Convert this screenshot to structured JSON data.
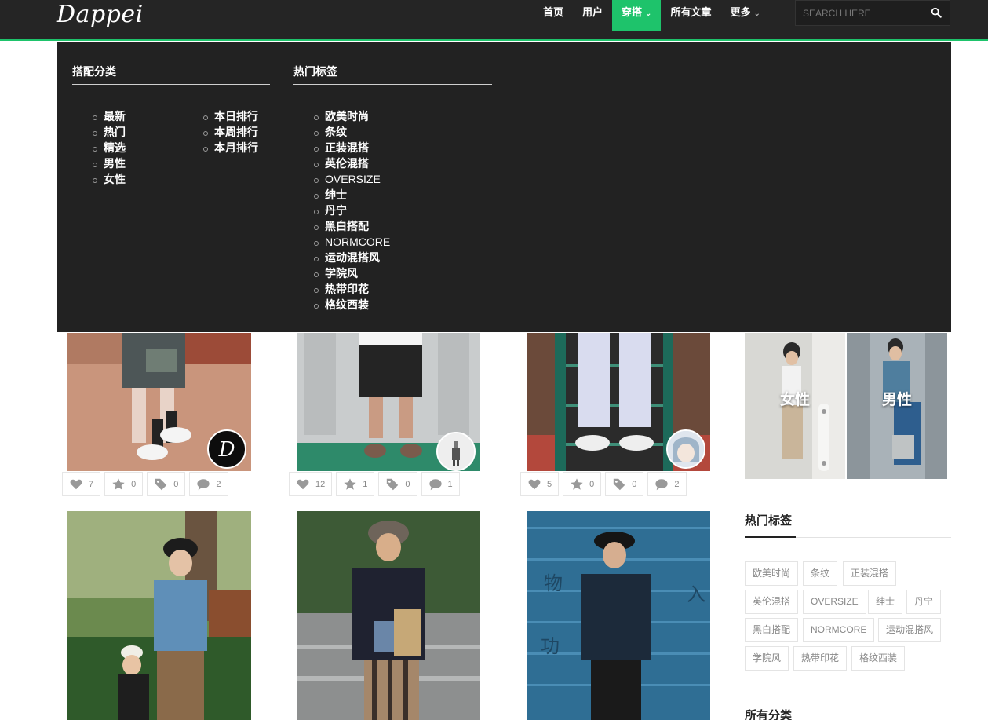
{
  "header": {
    "logo": "Dappei",
    "nav": [
      {
        "label": "首页",
        "active": false,
        "has_dropdown": false
      },
      {
        "label": "用户",
        "active": false,
        "has_dropdown": false
      },
      {
        "label": "穿搭",
        "active": true,
        "has_dropdown": true
      },
      {
        "label": "所有文章",
        "active": false,
        "has_dropdown": false
      },
      {
        "label": "更多",
        "active": false,
        "has_dropdown": true
      }
    ],
    "search_placeholder": "SEARCH HERE",
    "accent_color": "#1ec36b"
  },
  "mega_menu": {
    "categories_title": "搭配分类",
    "categories_col1": [
      "最新",
      "热门",
      "精选",
      "男性",
      "女性"
    ],
    "categories_col2": [
      "本日排行",
      "本周排行",
      "本月排行"
    ],
    "tags_title": "热门标签",
    "tags": [
      "欧美时尚",
      "条纹",
      "正装混搭",
      "英伦混搭",
      "OVERSIZE",
      "绅士",
      "丹宁",
      "黑白搭配",
      "NORMCORE",
      "运动混搭风",
      "学院风",
      "热带印花",
      "格纹西装"
    ]
  },
  "posts": [
    {
      "likes": "7",
      "favorites": "0",
      "tags": "0",
      "comments": "2"
    },
    {
      "likes": "12",
      "favorites": "1",
      "tags": "0",
      "comments": "1"
    },
    {
      "likes": "5",
      "favorites": "0",
      "tags": "0",
      "comments": "2"
    }
  ],
  "sidebar": {
    "gender_female": "女性",
    "gender_male": "男性",
    "hot_tags_title": "热门标签",
    "hot_tags": [
      "欧美时尚",
      "条纹",
      "正装混搭",
      "英伦混搭",
      "OVERSIZE",
      "绅士",
      "丹宁",
      "黑白搭配",
      "NORMCORE",
      "运动混搭风",
      "学院风",
      "热带印花",
      "格纹西装"
    ],
    "all_categories_title": "所有分类"
  }
}
